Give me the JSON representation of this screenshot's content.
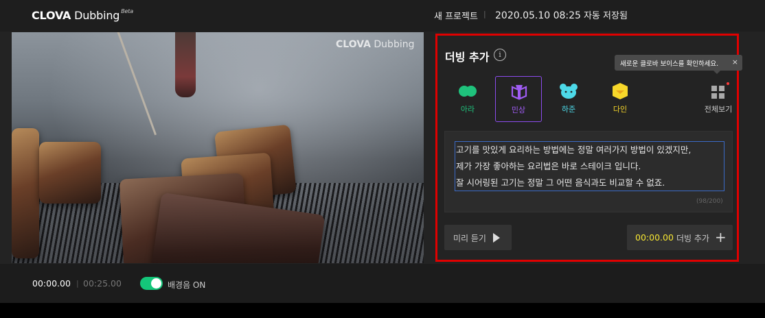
{
  "header": {
    "logo_brand": "CLOVA",
    "logo_product": "Dubbing",
    "logo_badge": "Beta",
    "project_name": "새 프로젝트",
    "timestamp": "2020.05.10 08:25",
    "save_status": "자동 저장됨"
  },
  "video": {
    "watermark_brand": "CLOVA",
    "watermark_product": "Dubbing"
  },
  "dubbing": {
    "title": "더빙 추가",
    "info_glyph": "i",
    "tooltip": "새로운 클로바 보이스를 확인하세요.",
    "tooltip_close": "×",
    "voices": [
      {
        "name": "아라",
        "color": "#1fc27c",
        "icon": "ara-voice-icon"
      },
      {
        "name": "민상",
        "color": "#a05cf5",
        "icon": "minsang-voice-icon",
        "selected": true
      },
      {
        "name": "하준",
        "color": "#4dd9e8",
        "icon": "hajun-voice-icon"
      },
      {
        "name": "다인",
        "color": "#f7d72a",
        "icon": "dain-voice-icon"
      }
    ],
    "view_all": "전체보기",
    "script_lines": [
      "고기를 맛있게 요리하는 방법에는 정말 여러가지 방법이 있겠지만,",
      "제가 가장 좋아하는 요리법은 바로 스테이크 입니다.",
      "잘 시어링된 고기는 정말 그 어떤 음식과도 비교할 수 없죠."
    ],
    "char_count": "(98/200)",
    "preview_label": "미리 듣기",
    "add_time": "00:00.00",
    "add_label": "더빙 추가",
    "add_glyph": "+"
  },
  "player": {
    "current_time": "00:00.00",
    "total_time": "00:25.00",
    "bgm_label": "배경음 ON",
    "bgm_on": true
  }
}
